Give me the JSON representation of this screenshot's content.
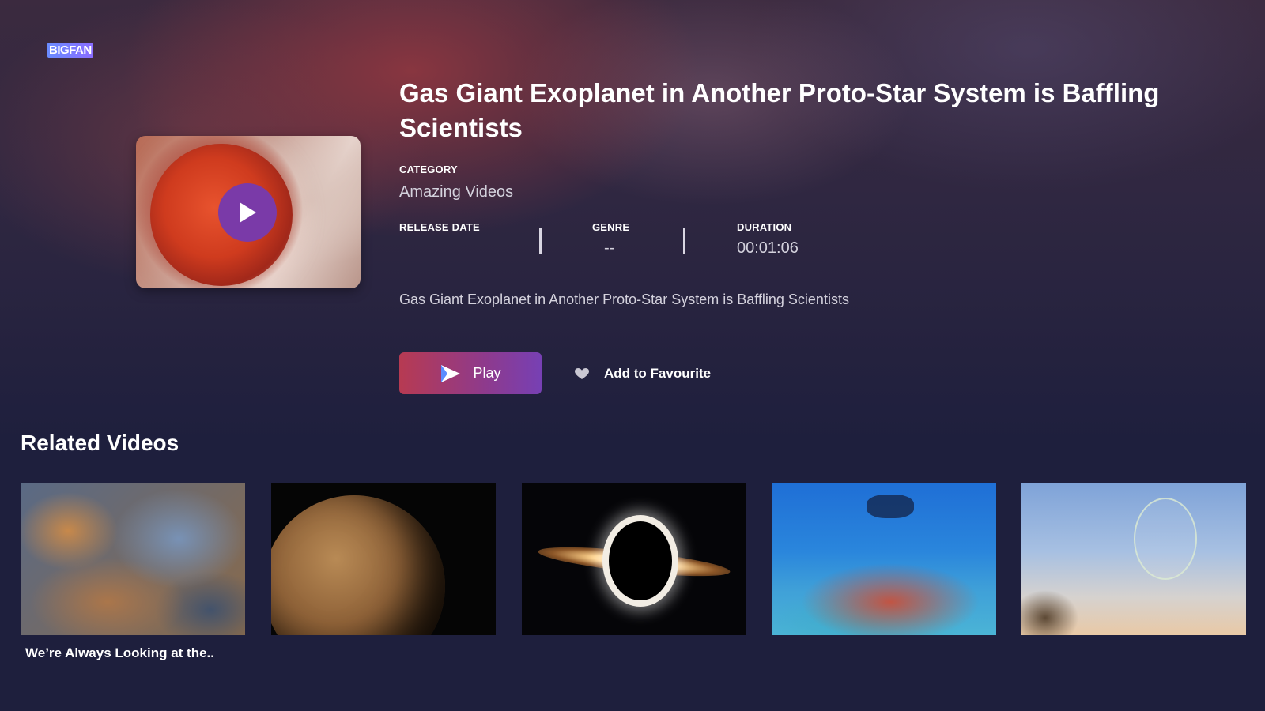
{
  "app": {
    "logo_text": "BIGFAN"
  },
  "video": {
    "title": "Gas Giant Exoplanet in Another Proto-Star System is Baffling Scientists",
    "category_label": "CATEGORY",
    "category_value": "Amazing Videos",
    "release_date_label": "RELEASE DATE",
    "release_date_value": "",
    "genre_label": "GENRE",
    "genre_value": "--",
    "duration_label": "DURATION",
    "duration_value": "00:01:06",
    "description": "Gas Giant Exoplanet in Another Proto-Star System is Baffling Scientists"
  },
  "actions": {
    "play_label": "Play",
    "favourite_label": "Add to Favourite"
  },
  "related": {
    "heading": "Related Videos",
    "items": [
      {
        "caption": "We’re Always Looking at the..",
        "image": "nebula"
      },
      {
        "caption": "",
        "image": "planet-mars"
      },
      {
        "caption": "",
        "image": "black-hole"
      },
      {
        "caption": "",
        "image": "coral-reef-diver"
      },
      {
        "caption": "",
        "image": "bubble-in-sky"
      }
    ]
  },
  "colors": {
    "background": "#1e1f3d",
    "play_button_gradient_start": "#b73a52",
    "play_button_gradient_end": "#7740b4",
    "play_circle": "#7a3aa8"
  },
  "icons": {
    "thumbnail_play": "play-icon",
    "button_play": "play-icon",
    "favourite": "heart-icon"
  }
}
